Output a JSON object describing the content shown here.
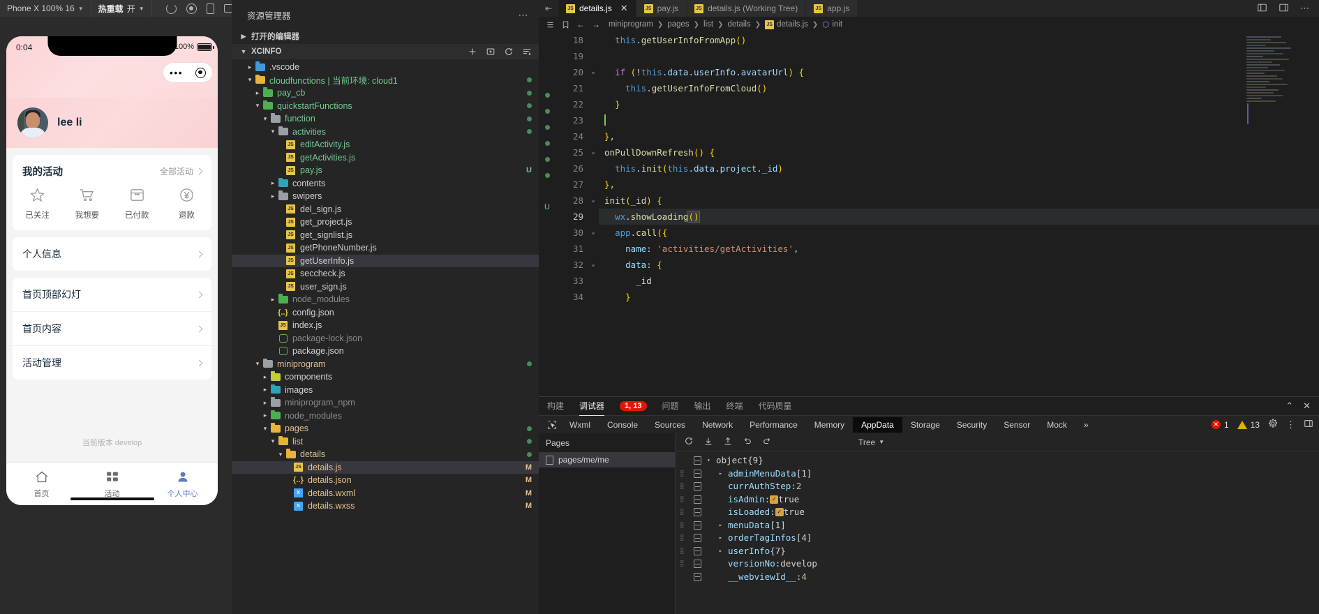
{
  "simulator": {
    "toolbar": {
      "device": "Phone X 100% 16",
      "hot_reload_label": "热重载",
      "hot_reload_state": "开",
      "icons": [
        "refresh-icon",
        "record-icon",
        "phone-icon",
        "tablet-icon"
      ]
    },
    "status_bar": {
      "time": "0:04",
      "battery_percent": "100%"
    },
    "user": {
      "name": "lee li"
    },
    "activity_card": {
      "title": "我的活动",
      "more_label": "全部活动",
      "items": [
        {
          "label": "已关注",
          "icon": "star-icon"
        },
        {
          "label": "我想要",
          "icon": "cart-icon"
        },
        {
          "label": "已付款",
          "icon": "box-icon"
        },
        {
          "label": "退款",
          "icon": "refund-icon"
        }
      ]
    },
    "menu_single": [
      {
        "label": "个人信息"
      }
    ],
    "menu_group": [
      {
        "label": "首页顶部幻灯"
      },
      {
        "label": "首页内容"
      },
      {
        "label": "活动管理"
      }
    ],
    "version_text": "当前版本 develop",
    "tabbar": [
      {
        "label": "首页",
        "icon": "home-icon",
        "active": false
      },
      {
        "label": "活动",
        "icon": "grid-icon",
        "active": false
      },
      {
        "label": "个人中心",
        "icon": "person-icon",
        "active": true
      }
    ]
  },
  "explorer": {
    "title": "资源管理器",
    "open_editors_label": "打开的编辑器",
    "root_label": "XCINFO",
    "root_actions": [
      "new-file-icon",
      "new-folder-icon",
      "refresh-icon",
      "collapse-icon"
    ],
    "tree": [
      {
        "indent": 1,
        "twisty": "▸",
        "icon": "folder-vscode",
        "color": "#3c9ae0",
        "name": ".vscode",
        "style": "plain",
        "badge": ""
      },
      {
        "indent": 1,
        "twisty": "▾",
        "icon": "folder",
        "color": "#e8b339",
        "name": "cloudfunctions | 当前环境: cloud1",
        "style": "green",
        "badge": "dot"
      },
      {
        "indent": 2,
        "twisty": "▸",
        "icon": "folder",
        "color": "#4caf50",
        "name": "pay_cb",
        "style": "green",
        "badge": "dot"
      },
      {
        "indent": 2,
        "twisty": "▾",
        "icon": "folder",
        "color": "#4caf50",
        "name": "quickstartFunctions",
        "style": "green",
        "badge": "dot"
      },
      {
        "indent": 3,
        "twisty": "▾",
        "icon": "folder",
        "color": "#9aa0a6",
        "name": "function",
        "style": "green",
        "badge": "dot"
      },
      {
        "indent": 4,
        "twisty": "▾",
        "icon": "folder",
        "color": "#9aa0a6",
        "name": "activities",
        "style": "green",
        "badge": "dot"
      },
      {
        "indent": 5,
        "twisty": "",
        "icon": "js",
        "color": "",
        "name": "editActivity.js",
        "style": "green",
        "badge": ""
      },
      {
        "indent": 5,
        "twisty": "",
        "icon": "js",
        "color": "",
        "name": "getActivities.js",
        "style": "green",
        "badge": ""
      },
      {
        "indent": 5,
        "twisty": "",
        "icon": "js",
        "color": "",
        "name": "pay.js",
        "style": "green",
        "badge": "U"
      },
      {
        "indent": 4,
        "twisty": "▸",
        "icon": "folder",
        "color": "#2fa4b8",
        "name": "contents",
        "style": "plain",
        "badge": ""
      },
      {
        "indent": 4,
        "twisty": "▸",
        "icon": "folder",
        "color": "#9aa0a6",
        "name": "swipers",
        "style": "plain",
        "badge": ""
      },
      {
        "indent": 5,
        "twisty": "",
        "icon": "js",
        "color": "",
        "name": "del_sign.js",
        "style": "plain",
        "badge": ""
      },
      {
        "indent": 5,
        "twisty": "",
        "icon": "js",
        "color": "",
        "name": "get_project.js",
        "style": "plain",
        "badge": ""
      },
      {
        "indent": 5,
        "twisty": "",
        "icon": "js",
        "color": "",
        "name": "get_signlist.js",
        "style": "plain",
        "badge": ""
      },
      {
        "indent": 5,
        "twisty": "",
        "icon": "js",
        "color": "",
        "name": "getPhoneNumber.js",
        "style": "plain",
        "badge": ""
      },
      {
        "indent": 5,
        "twisty": "",
        "icon": "js",
        "color": "",
        "name": "getUserInfo.js",
        "style": "plain",
        "badge": "",
        "selected": true
      },
      {
        "indent": 5,
        "twisty": "",
        "icon": "js",
        "color": "",
        "name": "seccheck.js",
        "style": "plain",
        "badge": ""
      },
      {
        "indent": 5,
        "twisty": "",
        "icon": "js",
        "color": "",
        "name": "user_sign.js",
        "style": "plain",
        "badge": ""
      },
      {
        "indent": 4,
        "twisty": "▸",
        "icon": "folder",
        "color": "#4caf50",
        "name": "node_modules",
        "style": "dim",
        "badge": ""
      },
      {
        "indent": 4,
        "twisty": "",
        "icon": "json",
        "color": "",
        "name": "config.json",
        "style": "plain",
        "badge": ""
      },
      {
        "indent": 4,
        "twisty": "",
        "icon": "js",
        "color": "",
        "name": "index.js",
        "style": "plain",
        "badge": ""
      },
      {
        "indent": 4,
        "twisty": "",
        "icon": "node",
        "color": "",
        "name": "package-lock.json",
        "style": "dim",
        "badge": ""
      },
      {
        "indent": 4,
        "twisty": "",
        "icon": "node",
        "color": "",
        "name": "package.json",
        "style": "plain",
        "badge": ""
      },
      {
        "indent": 2,
        "twisty": "▾",
        "icon": "folder",
        "color": "#9aa0a6",
        "name": "miniprogram",
        "style": "mod",
        "badge": "dot"
      },
      {
        "indent": 3,
        "twisty": "▸",
        "icon": "folder",
        "color": "#c3cf3a",
        "name": "components",
        "style": "plain",
        "badge": ""
      },
      {
        "indent": 3,
        "twisty": "▸",
        "icon": "folder",
        "color": "#2fa4b8",
        "name": "images",
        "style": "plain",
        "badge": ""
      },
      {
        "indent": 3,
        "twisty": "▸",
        "icon": "folder",
        "color": "#9aa0a6",
        "name": "miniprogram_npm",
        "style": "dim",
        "badge": ""
      },
      {
        "indent": 3,
        "twisty": "▸",
        "icon": "folder",
        "color": "#4caf50",
        "name": "node_modules",
        "style": "dim",
        "badge": ""
      },
      {
        "indent": 3,
        "twisty": "▾",
        "icon": "folder",
        "color": "#e8b339",
        "name": "pages",
        "style": "mod",
        "badge": "dot"
      },
      {
        "indent": 4,
        "twisty": "▾",
        "icon": "folder",
        "color": "#e8b339",
        "name": "list",
        "style": "mod",
        "badge": "dot"
      },
      {
        "indent": 5,
        "twisty": "▾",
        "icon": "folder",
        "color": "#e8b339",
        "name": "details",
        "style": "mod",
        "badge": "dot"
      },
      {
        "indent": 6,
        "twisty": "",
        "icon": "js",
        "color": "",
        "name": "details.js",
        "style": "mod",
        "badge": "M",
        "selected": true
      },
      {
        "indent": 6,
        "twisty": "",
        "icon": "json",
        "color": "",
        "name": "details.json",
        "style": "mod",
        "badge": "M"
      },
      {
        "indent": 6,
        "twisty": "",
        "icon": "wxml",
        "color": "",
        "name": "details.wxml",
        "style": "mod",
        "badge": "M"
      },
      {
        "indent": 6,
        "twisty": "",
        "icon": "wxss",
        "color": "",
        "name": "details.wxss",
        "style": "mod",
        "badge": "M"
      }
    ]
  },
  "editor": {
    "tabs": [
      {
        "label": "details.js",
        "active": true,
        "closable": true
      },
      {
        "label": "pay.js",
        "active": false,
        "closable": false
      },
      {
        "label": "details.js (Working Tree)",
        "active": false,
        "closable": false
      },
      {
        "label": "app.js",
        "active": false,
        "closable": false
      }
    ],
    "window_controls": [
      "layout-icon",
      "panel-icon",
      "more-icon"
    ],
    "breadcrumb": [
      "miniprogram",
      "pages",
      "list",
      "details",
      "details.js",
      "init"
    ],
    "breadcrumb_icons": [
      "outline-icon",
      "bookmark-icon",
      "back-arrow-icon",
      "forward-arrow-icon"
    ],
    "current_line": 29,
    "lines": [
      {
        "n": 18,
        "fold": "",
        "text": "  this.getUserInfoFromApp()"
      },
      {
        "n": 19,
        "fold": "",
        "text": ""
      },
      {
        "n": 20,
        "fold": "v",
        "text": "  if (!this.data.userInfo.avatarUrl) {"
      },
      {
        "n": 21,
        "fold": "",
        "text": "    this.getUserInfoFromCloud()"
      },
      {
        "n": 22,
        "fold": "",
        "text": "  }"
      },
      {
        "n": 23,
        "fold": "",
        "text": ""
      },
      {
        "n": 24,
        "fold": "",
        "text": "},"
      },
      {
        "n": 25,
        "fold": "v",
        "text": "onPullDownRefresh() {"
      },
      {
        "n": 26,
        "fold": "",
        "text": "  this.init(this.data.project._id)"
      },
      {
        "n": 27,
        "fold": "",
        "text": "},"
      },
      {
        "n": 28,
        "fold": "v",
        "text": "init(_id) {"
      },
      {
        "n": 29,
        "fold": "",
        "text": "  wx.showLoading()"
      },
      {
        "n": 30,
        "fold": "v",
        "text": "  app.call({"
      },
      {
        "n": 31,
        "fold": "",
        "text": "    name: 'activities/getActivities',"
      },
      {
        "n": 32,
        "fold": "v",
        "text": "    data: {"
      },
      {
        "n": 33,
        "fold": "",
        "text": "      _id"
      },
      {
        "n": 34,
        "fold": "",
        "text": "    }"
      }
    ]
  },
  "panel": {
    "tabs": [
      {
        "label": "构建",
        "active": false
      },
      {
        "label": "调试器",
        "active": true,
        "badge": "1, 13"
      },
      {
        "label": "问题",
        "active": false
      },
      {
        "label": "输出",
        "active": false
      },
      {
        "label": "终端",
        "active": false
      },
      {
        "label": "代码质量",
        "active": false
      }
    ],
    "panel_controls": [
      "chevron-up-icon",
      "close-icon"
    ],
    "devtools_tabs": [
      {
        "label": "Wxml",
        "active": false
      },
      {
        "label": "Console",
        "active": false
      },
      {
        "label": "Sources",
        "active": false
      },
      {
        "label": "Network",
        "active": false
      },
      {
        "label": "Performance",
        "active": false
      },
      {
        "label": "Memory",
        "active": false
      },
      {
        "label": "AppData",
        "active": true
      },
      {
        "label": "Storage",
        "active": false
      },
      {
        "label": "Security",
        "active": false
      },
      {
        "label": "Sensor",
        "active": false
      },
      {
        "label": "Mock",
        "active": false
      }
    ],
    "devtools_overflow": "»",
    "error_count": "1",
    "warning_count": "13",
    "pages_title": "Pages",
    "pages_items": [
      {
        "label": "pages/me/me",
        "selected": true
      }
    ],
    "data_toolbar": {
      "icons": [
        "refresh-icon",
        "expand-icon",
        "collapse-icon",
        "undo-icon",
        "redo-icon"
      ],
      "view_mode": "Tree"
    },
    "data_rows": [
      {
        "indent": 0,
        "arrow": "▾",
        "key": "object",
        "sep": "",
        "value": "{9}",
        "vtype": "txt",
        "grip": false
      },
      {
        "indent": 1,
        "arrow": "▸",
        "key": "adminMenuData",
        "sep": "",
        "value": "[1]",
        "vtype": "txt",
        "grip": true
      },
      {
        "indent": 1,
        "arrow": "",
        "key": "currAuthStep",
        "sep": ":",
        "value": "2",
        "vtype": "num",
        "grip": true
      },
      {
        "indent": 1,
        "arrow": "",
        "key": "isAdmin",
        "sep": ":",
        "value": "true",
        "vtype": "check",
        "grip": true
      },
      {
        "indent": 1,
        "arrow": "",
        "key": "isLoaded",
        "sep": ":",
        "value": "true",
        "vtype": "check",
        "grip": true
      },
      {
        "indent": 1,
        "arrow": "▸",
        "key": "menuData",
        "sep": "",
        "value": "[1]",
        "vtype": "txt",
        "grip": true
      },
      {
        "indent": 1,
        "arrow": "▸",
        "key": "orderTagInfos",
        "sep": "",
        "value": "[4]",
        "vtype": "txt",
        "grip": true
      },
      {
        "indent": 1,
        "arrow": "▸",
        "key": "userInfo",
        "sep": "",
        "value": "{7}",
        "vtype": "txt",
        "grip": true
      },
      {
        "indent": 1,
        "arrow": "",
        "key": "versionNo",
        "sep": ":",
        "value": "develop",
        "vtype": "txt",
        "grip": true
      },
      {
        "indent": 1,
        "arrow": "",
        "key": "__webviewId__",
        "sep": ":",
        "value": "4",
        "vtype": "num",
        "grip": false
      }
    ]
  },
  "colors": {
    "accent_green": "#73c991",
    "accent_yellow": "#e2c08d",
    "error_red": "#e51400",
    "warn_yellow": "#ddb100",
    "editor_bg": "#1e1e1e"
  }
}
